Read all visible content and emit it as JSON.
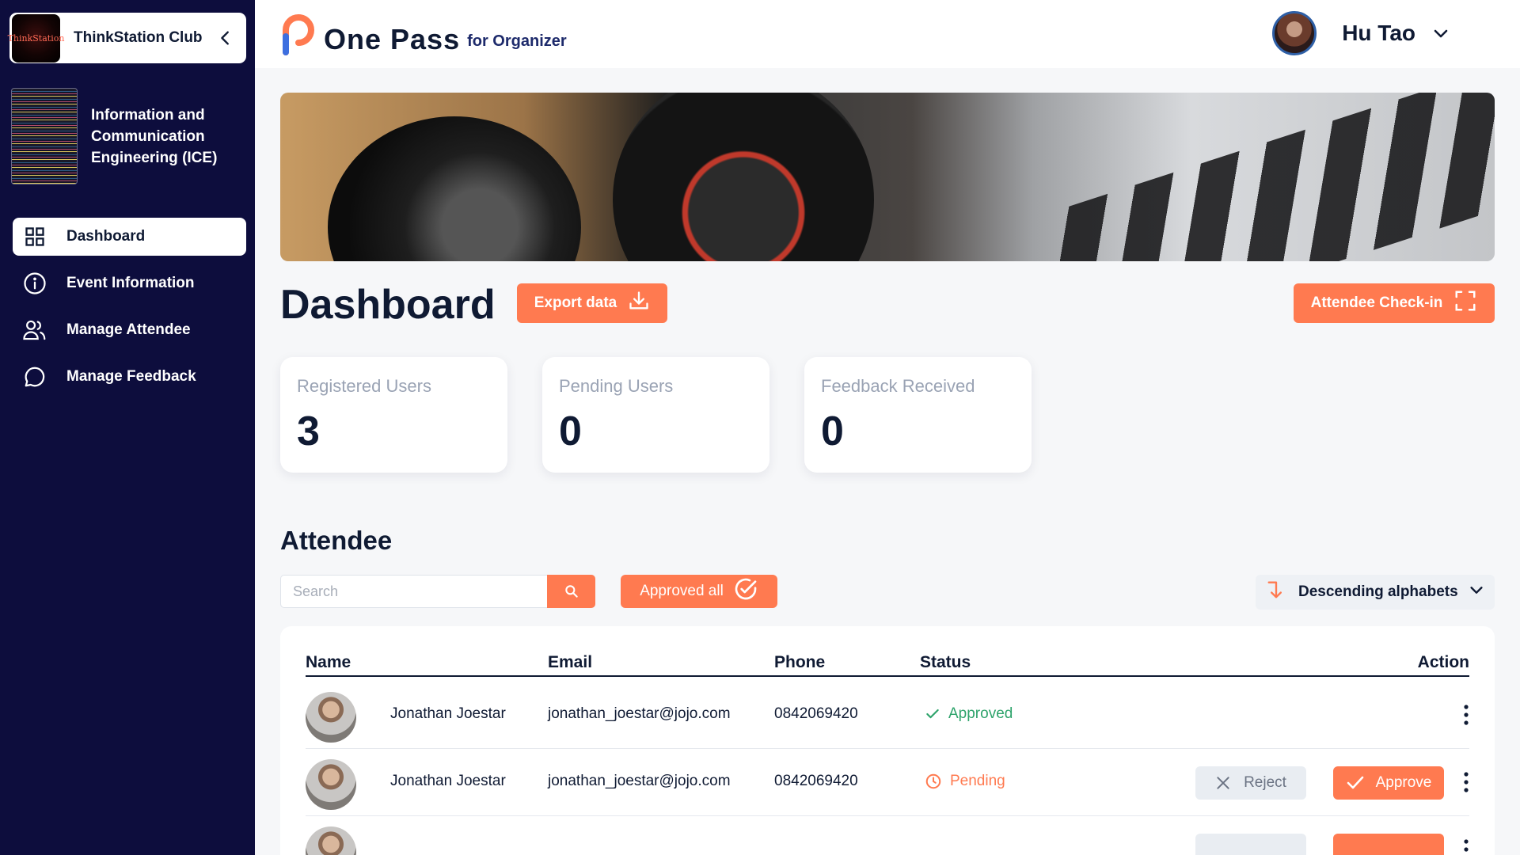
{
  "sidebar": {
    "club": {
      "name": "ThinkStation Club",
      "logo_text": "ThinkStation"
    },
    "department": {
      "name": "Information and Communication Engineering (ICE)"
    },
    "nav": [
      {
        "label": "Dashboard",
        "icon": "grid-icon",
        "active": true
      },
      {
        "label": "Event Information",
        "icon": "info-icon",
        "active": false
      },
      {
        "label": "Manage Attendee",
        "icon": "users-icon",
        "active": false
      },
      {
        "label": "Manage Feedback",
        "icon": "chat-bubble-icon",
        "active": false
      }
    ]
  },
  "header": {
    "brand_name": "One Pass",
    "brand_sub": "for Organizer",
    "user_name": "Hu Tao"
  },
  "main": {
    "title": "Dashboard",
    "export_label": "Export data",
    "checkin_label": "Attendee Check-in",
    "stats": [
      {
        "label": "Registered Users",
        "value": "3"
      },
      {
        "label": "Pending Users",
        "value": "0"
      },
      {
        "label": "Feedback Received",
        "value": "0"
      }
    ],
    "attendee": {
      "title": "Attendee",
      "search_placeholder": "Search",
      "approve_all_label": "Approved all",
      "sort_label": "Descending alphabets",
      "columns": [
        "Name",
        "Email",
        "Phone",
        "Status",
        "Action"
      ],
      "rows": [
        {
          "name": "Jonathan Joestar",
          "email": "jonathan_joestar@jojo.com",
          "phone": "0842069420",
          "status": "Approved"
        },
        {
          "name": "Jonathan Joestar",
          "email": "jonathan_joestar@jojo.com",
          "phone": "0842069420",
          "status": "Pending",
          "reject_label": "Reject",
          "approve_label": "Approve"
        }
      ]
    }
  },
  "colors": {
    "sidebar_bg": "#0d0d3d",
    "accent": "#ff7a50",
    "approved": "#2ea36b",
    "text_dark": "#0f1a33"
  }
}
